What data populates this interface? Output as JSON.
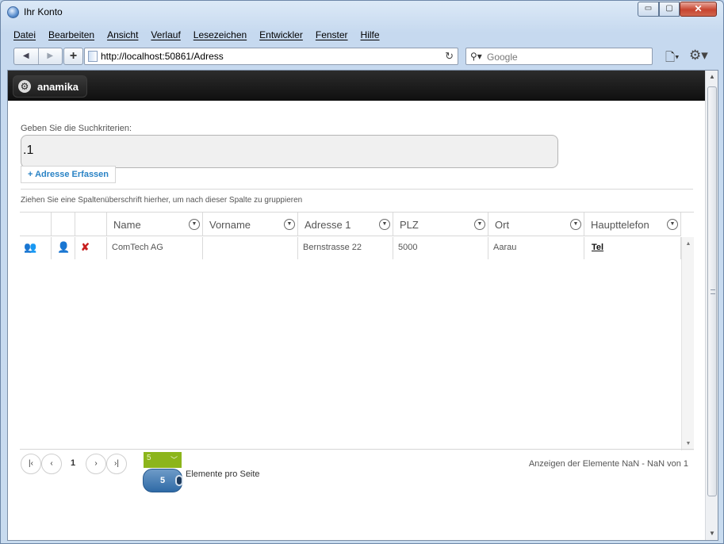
{
  "window": {
    "title": "Ihr Konto",
    "controls": {
      "minimize": "▭",
      "maximize": "▢",
      "close": "✕"
    }
  },
  "menu": [
    "Datei",
    "Bearbeiten",
    "Ansicht",
    "Verlauf",
    "Lesezeichen",
    "Entwickler",
    "Fenster",
    "Hilfe"
  ],
  "nav": {
    "back": "◀",
    "forward": "▶",
    "new_tab": "+",
    "url": "http://localhost:50861/Adress",
    "reload": "↻",
    "search_placeholder": "Google",
    "search_icon": "⚲▾",
    "page_menu": "🗋▾",
    "tools_menu": "⚙▾"
  },
  "app": {
    "brand": "anamika",
    "brand_icon": "⚙"
  },
  "search": {
    "label": "Geben Sie die Suchkriterien:",
    "value": ".1"
  },
  "add_button": "+ Adresse Erfassen",
  "group_hint": "Ziehen Sie eine Spaltenüberschrift hierher, um nach dieser Spalte zu gruppieren",
  "grid": {
    "columns": [
      "Name",
      "Vorname",
      "Adresse 1",
      "PLZ",
      "Ort",
      "Haupttelefon"
    ],
    "filter_glyph": "▼",
    "rows": [
      {
        "icons": [
          "users-icon",
          "user-icon",
          "delete-icon"
        ],
        "name": "ComTech AG",
        "vorname": "",
        "adresse": "Bernstrasse 22",
        "plz": "5000",
        "ort": "Aarau",
        "telefon": "Tel"
      }
    ]
  },
  "pager": {
    "first": "|‹",
    "prev": "‹",
    "current_page": "1",
    "next": "›",
    "last": "›|",
    "page_size_value": "5",
    "page_size_selected": "5",
    "page_size_label": "Elemente pro Seite",
    "info": "Anzeigen der Elemente NaN - NaN von 1"
  },
  "colors": {
    "accent_link": "#2a83c5",
    "pager_size": "#8cb51b",
    "select_blue": "#2f6aa6"
  }
}
